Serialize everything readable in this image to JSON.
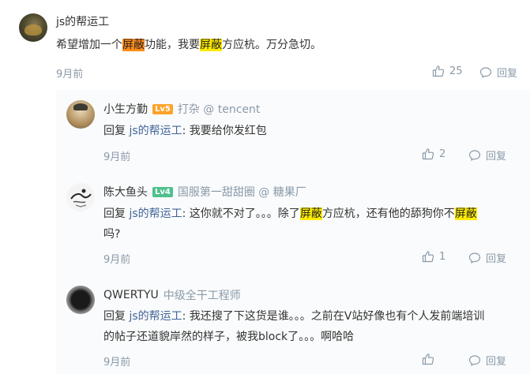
{
  "main_comment": {
    "author": "js的帮运工",
    "content_parts": [
      {
        "text": "希望增加一个",
        "hl": ""
      },
      {
        "text": "屏蔽",
        "hl": "orange"
      },
      {
        "text": "功能，我要",
        "hl": ""
      },
      {
        "text": "屏蔽",
        "hl": "yellow"
      },
      {
        "text": "方应杭。万分急切。",
        "hl": ""
      }
    ],
    "time": "9月前",
    "likes": "25",
    "reply_label": "回复"
  },
  "replies": [
    {
      "author": "小生方勤",
      "level": "Lv5",
      "job": "打杂 @ tencent",
      "reply_word": "回复 ",
      "reply_to": "js的帮运工",
      "lines": [
        [
          {
            "text": ": 我要给你发红包",
            "hl": ""
          }
        ]
      ],
      "time": "9月前",
      "likes": "2",
      "reply_label": "回复"
    },
    {
      "author": "陈大鱼头",
      "level": "Lv4",
      "job": "国服第一甜甜圈 @ 糖果厂",
      "reply_word": "回复 ",
      "reply_to": "js的帮运工",
      "lines": [
        [
          {
            "text": ": 这你就不对了。。。除了",
            "hl": ""
          },
          {
            "text": "屏蔽",
            "hl": "yellow"
          },
          {
            "text": "方应杭，还有他的舔狗你不",
            "hl": ""
          },
          {
            "text": "屏蔽",
            "hl": "yellow"
          }
        ],
        [
          {
            "text": "吗?",
            "hl": ""
          }
        ]
      ],
      "time": "9月前",
      "likes": "1",
      "reply_label": "回复"
    },
    {
      "author": "QWERTYU",
      "level": "",
      "job": "中级全干工程师",
      "reply_word": "回复 ",
      "reply_to": "js的帮运工",
      "lines": [
        [
          {
            "text": ": 我还搜了下这货是谁。。。之前在V站好像也有个人发前端培训",
            "hl": ""
          }
        ],
        [
          {
            "text": "的帖子还道貌岸然的样子，被我block了。。。啊哈哈",
            "hl": ""
          }
        ]
      ],
      "time": "9月前",
      "likes": "",
      "reply_label": "回复"
    }
  ]
}
